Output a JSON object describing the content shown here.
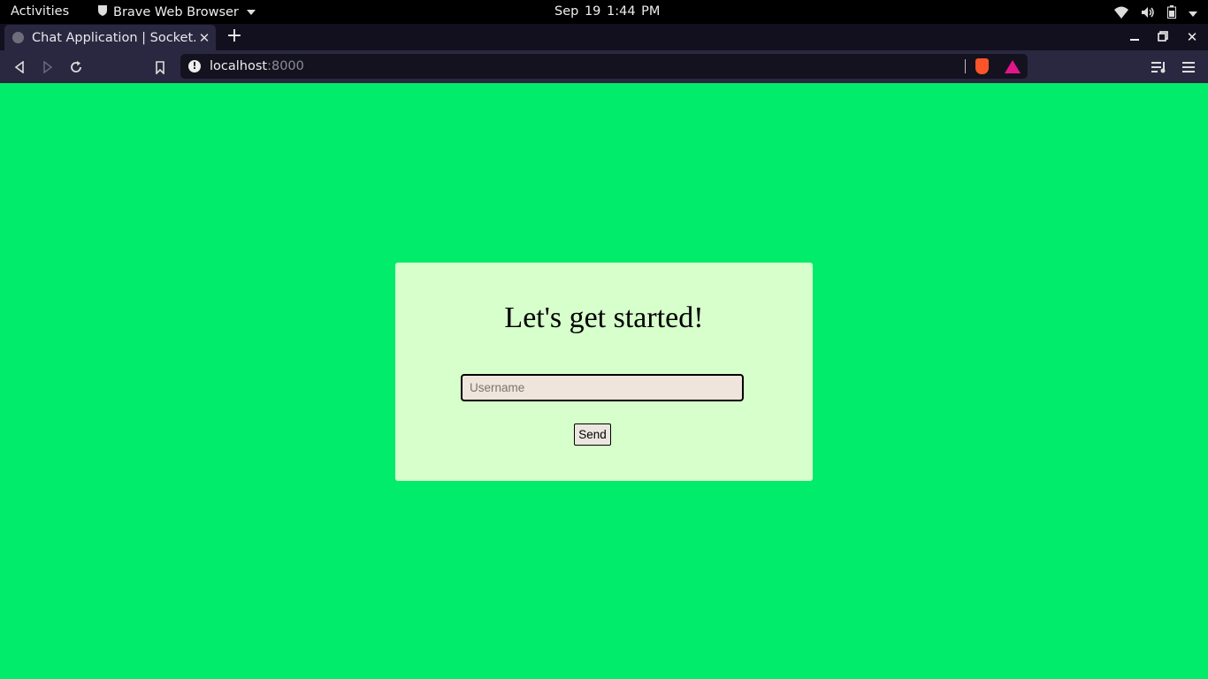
{
  "system_bar": {
    "activities": "Activities",
    "app_name": "Brave Web Browser",
    "clock": "Sep 19  1:44 PM"
  },
  "browser": {
    "tab_title": "Chat Application | Socket.io",
    "url_host": "localhost",
    "url_port": ":8000"
  },
  "page": {
    "heading": "Let's get started!",
    "username_placeholder": "Username",
    "send_label": "Send",
    "background_color": "#00ec6a",
    "card_color": "#d6ffcb"
  }
}
